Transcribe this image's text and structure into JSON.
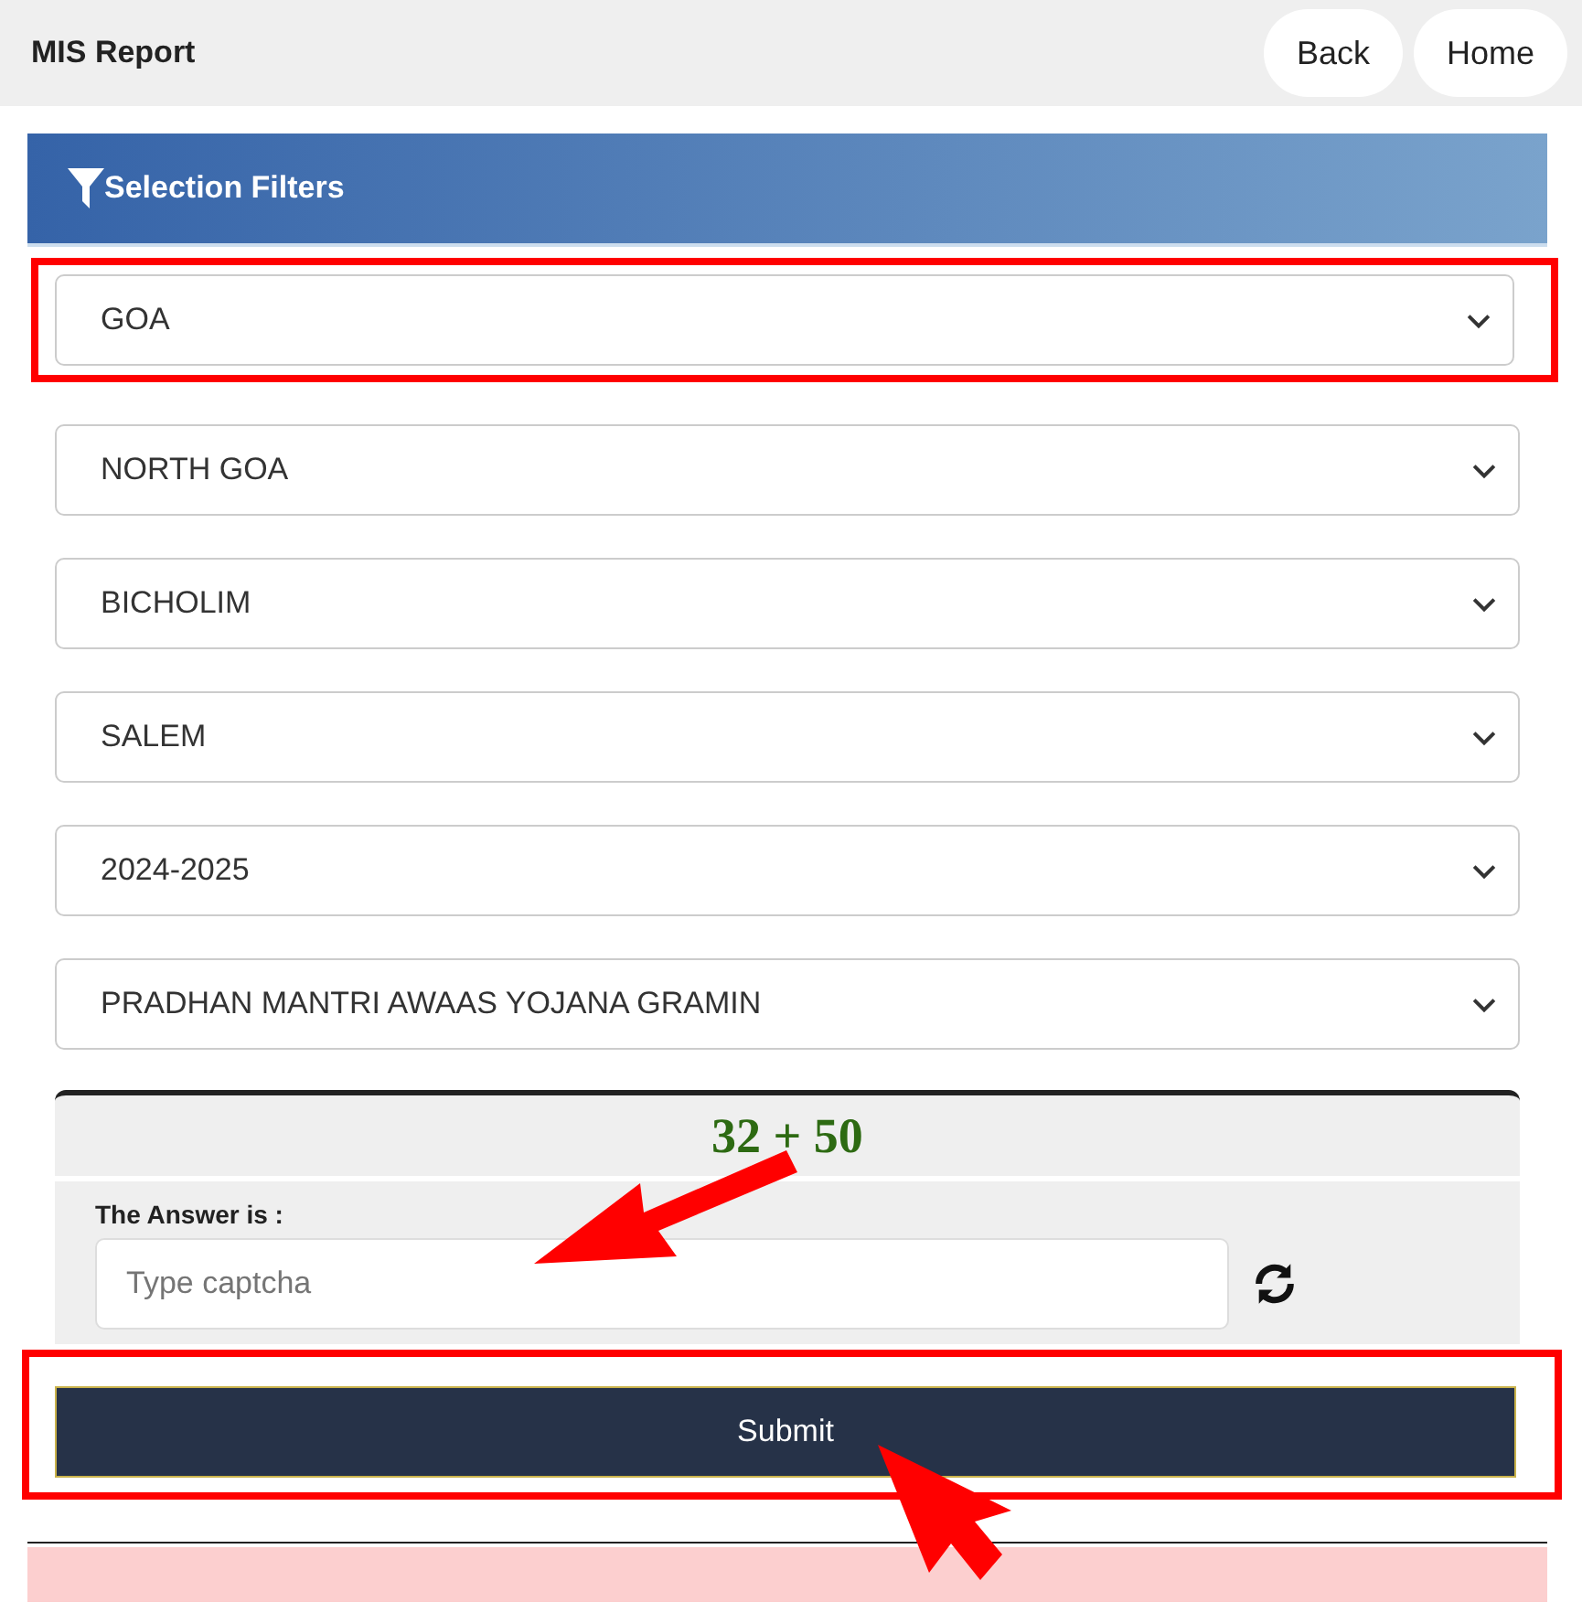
{
  "header": {
    "title": "MIS Report",
    "buttons": [
      "Back",
      "Home"
    ]
  },
  "filters": {
    "title": "Selection Filters",
    "selects": [
      {
        "value": "GOA",
        "highlighted": true
      },
      {
        "value": "NORTH GOA",
        "highlighted": false
      },
      {
        "value": "BICHOLIM",
        "highlighted": false
      },
      {
        "value": "SALEM",
        "highlighted": false
      },
      {
        "value": "2024-2025",
        "highlighted": false
      },
      {
        "value": "PRADHAN MANTRI AWAAS YOJANA GRAMIN",
        "highlighted": false
      }
    ]
  },
  "captcha": {
    "question": "32 + 50",
    "label": "The Answer is :",
    "placeholder": "Type captcha"
  },
  "submit": {
    "label": "Submit",
    "highlighted": true
  }
}
